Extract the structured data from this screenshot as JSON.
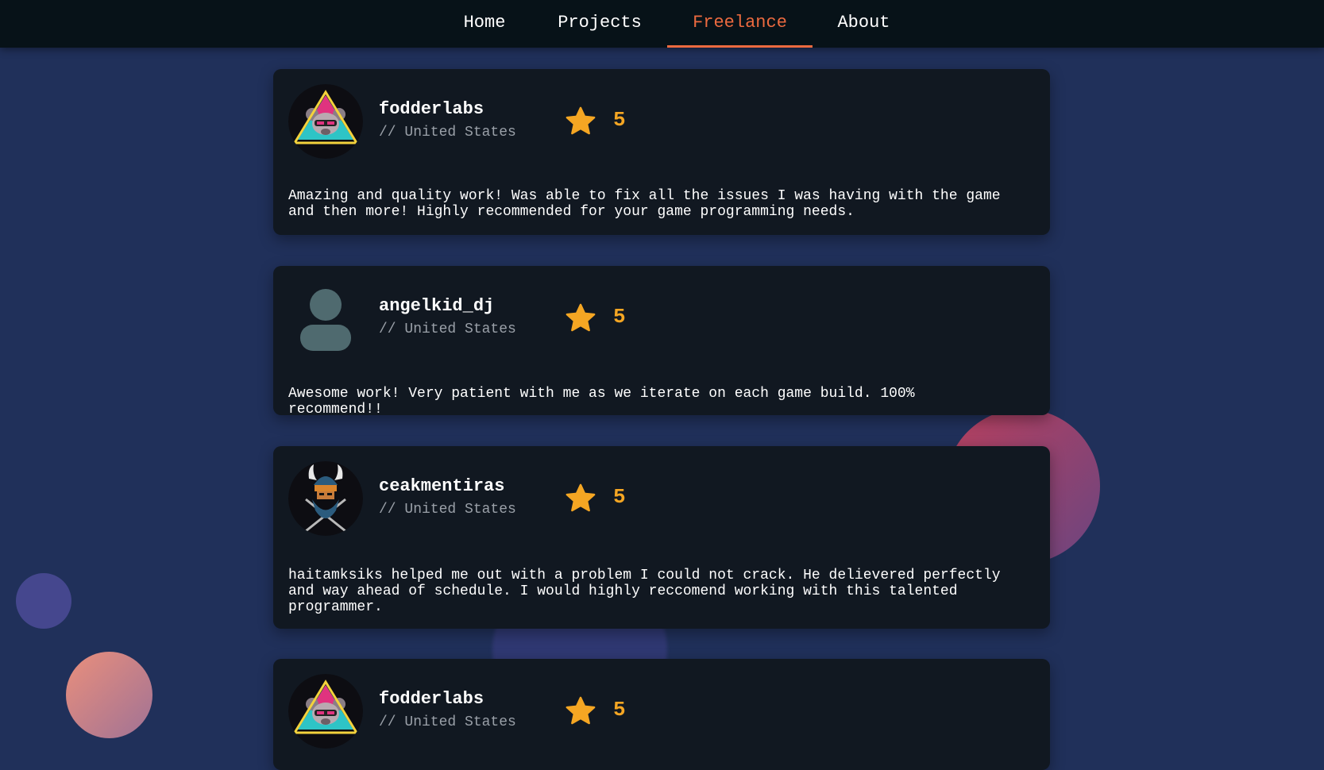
{
  "nav": {
    "items": [
      {
        "label": "Home",
        "active": false
      },
      {
        "label": "Projects",
        "active": false
      },
      {
        "label": "Freelance",
        "active": true
      },
      {
        "label": "About",
        "active": false
      }
    ]
  },
  "colors": {
    "background": "#20305a",
    "nav_background": "#071218",
    "card_background": "#111821",
    "accent": "#ec6a3f",
    "star": "#f5a623",
    "muted_text": "#9aa0a8"
  },
  "reviews": [
    {
      "name": "fodderlabs",
      "country": "// United States",
      "rating": "5",
      "avatar": "raccoon-triangle-logo",
      "text": "Amazing and quality work! Was able to fix all the issues I was having with the game and then more! Highly recommended for your game programming needs."
    },
    {
      "name": "angelkid_dj",
      "country": "// United States",
      "rating": "5",
      "avatar": "default-user-silhouette",
      "text": "Awesome work! Very patient with me as we iterate on each game build. 100% recommend!!"
    },
    {
      "name": "ceakmentiras",
      "country": "// United States",
      "rating": "5",
      "avatar": "viking-warrior-logo",
      "text": "haitamksiks helped me out with a problem I could not crack. He delievered perfectly and way ahead of schedule. I would highly reccomend working with this talented programmer."
    },
    {
      "name": "fodderlabs",
      "country": "// United States",
      "rating": "5",
      "avatar": "raccoon-triangle-logo",
      "text": ""
    }
  ]
}
